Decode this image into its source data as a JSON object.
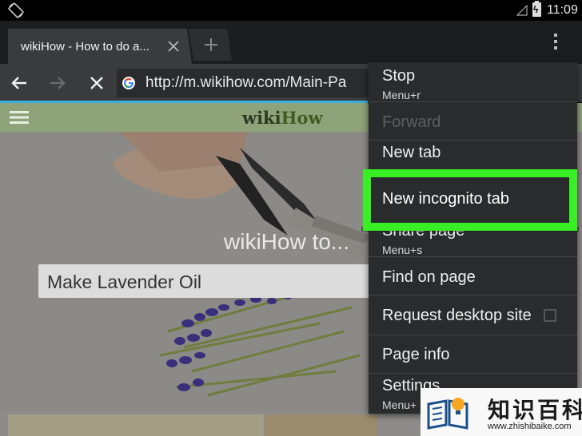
{
  "status_bar": {
    "time": "11:09",
    "icons": [
      "rotate-icon",
      "signal-icon",
      "battery-charging-icon"
    ]
  },
  "tab": {
    "title": "wikiHow - How to do a...",
    "close_icon": "close-icon",
    "new_tab_icon": "plus-icon"
  },
  "toolbar": {
    "url": "http://m.wikihow.com/Main-Pa",
    "icons": [
      "back-icon",
      "forward-icon",
      "stop-icon",
      "google-icon",
      "overflow-icon"
    ]
  },
  "page": {
    "logo_part1": "wiki",
    "logo_part2": "How",
    "hero_heading": "wikiHow to...",
    "search_value": "Make Lavender Oil"
  },
  "menu": {
    "stop": {
      "label": "Stop",
      "shortcut": "Menu+r"
    },
    "forward": {
      "label": "Forward"
    },
    "new_tab": {
      "label": "New tab"
    },
    "new_incognito_tab": {
      "label": "New incognito tab"
    },
    "share_page": {
      "label": "Share page",
      "shortcut": "Menu+s"
    },
    "find_on_page": {
      "label": "Find on page"
    },
    "request_desktop_site": {
      "label": "Request desktop site",
      "checked": false
    },
    "page_info": {
      "label": "Page info"
    },
    "settings": {
      "label": "Settings",
      "shortcut": "Menu+"
    }
  },
  "highlight_color": "#38ef25",
  "accent_color": "#38b0dd",
  "watermark": {
    "title": "知识百科",
    "url": "www.zhishibaike.com"
  }
}
